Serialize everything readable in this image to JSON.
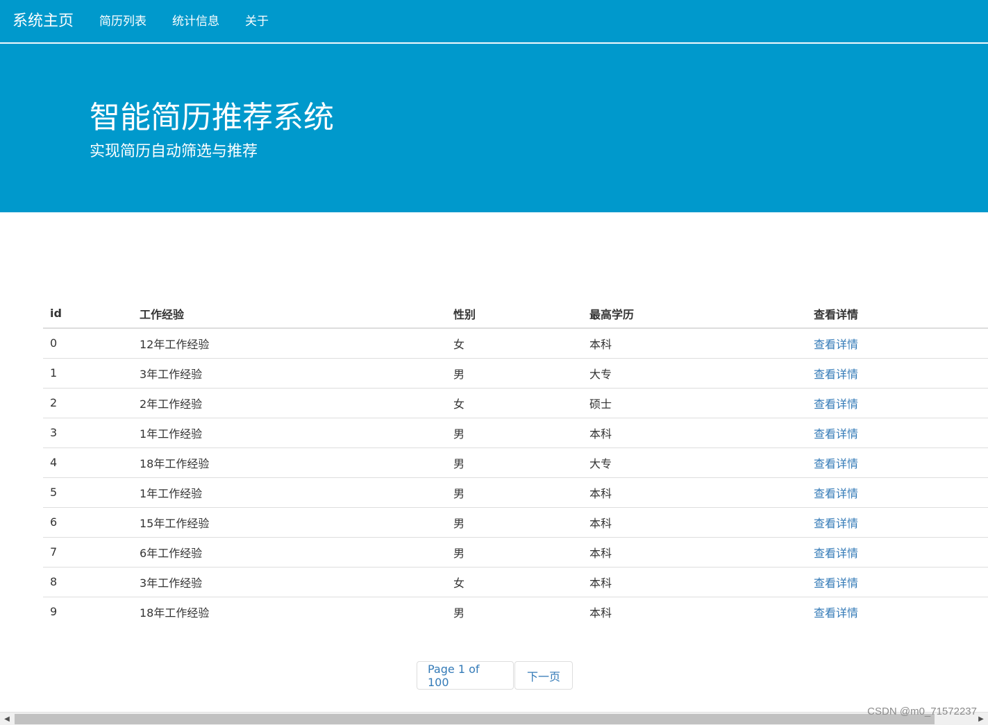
{
  "navbar": {
    "brand": "系统主页",
    "links": [
      "简历列表",
      "统计信息",
      "关于"
    ]
  },
  "hero": {
    "title": "智能简历推荐系统",
    "subtitle": "实现简历自动筛选与推荐"
  },
  "table": {
    "headers": [
      "id",
      "工作经验",
      "性别",
      "最高学历",
      "查看详情"
    ],
    "rows": [
      [
        "0",
        "12年工作经验",
        "女",
        "本科",
        "查看详情"
      ],
      [
        "1",
        "3年工作经验",
        "男",
        "大专",
        "查看详情"
      ],
      [
        "2",
        "2年工作经验",
        "女",
        "硕士",
        "查看详情"
      ],
      [
        "3",
        "1年工作经验",
        "男",
        "本科",
        "查看详情"
      ],
      [
        "4",
        "18年工作经验",
        "男",
        "大专",
        "查看详情"
      ],
      [
        "5",
        "1年工作经验",
        "男",
        "本科",
        "查看详情"
      ],
      [
        "6",
        "15年工作经验",
        "男",
        "本科",
        "查看详情"
      ],
      [
        "7",
        "6年工作经验",
        "男",
        "本科",
        "查看详情"
      ],
      [
        "8",
        "3年工作经验",
        "女",
        "本科",
        "查看详情"
      ],
      [
        "9",
        "18年工作经验",
        "男",
        "本科",
        "查看详情"
      ]
    ]
  },
  "pagination": {
    "page_info": "Page 1 of 100",
    "next_label": "下一页"
  },
  "watermark": "CSDN @m0_71572237",
  "colors": {
    "primary": "#0099cc",
    "link": "#337ab7"
  }
}
